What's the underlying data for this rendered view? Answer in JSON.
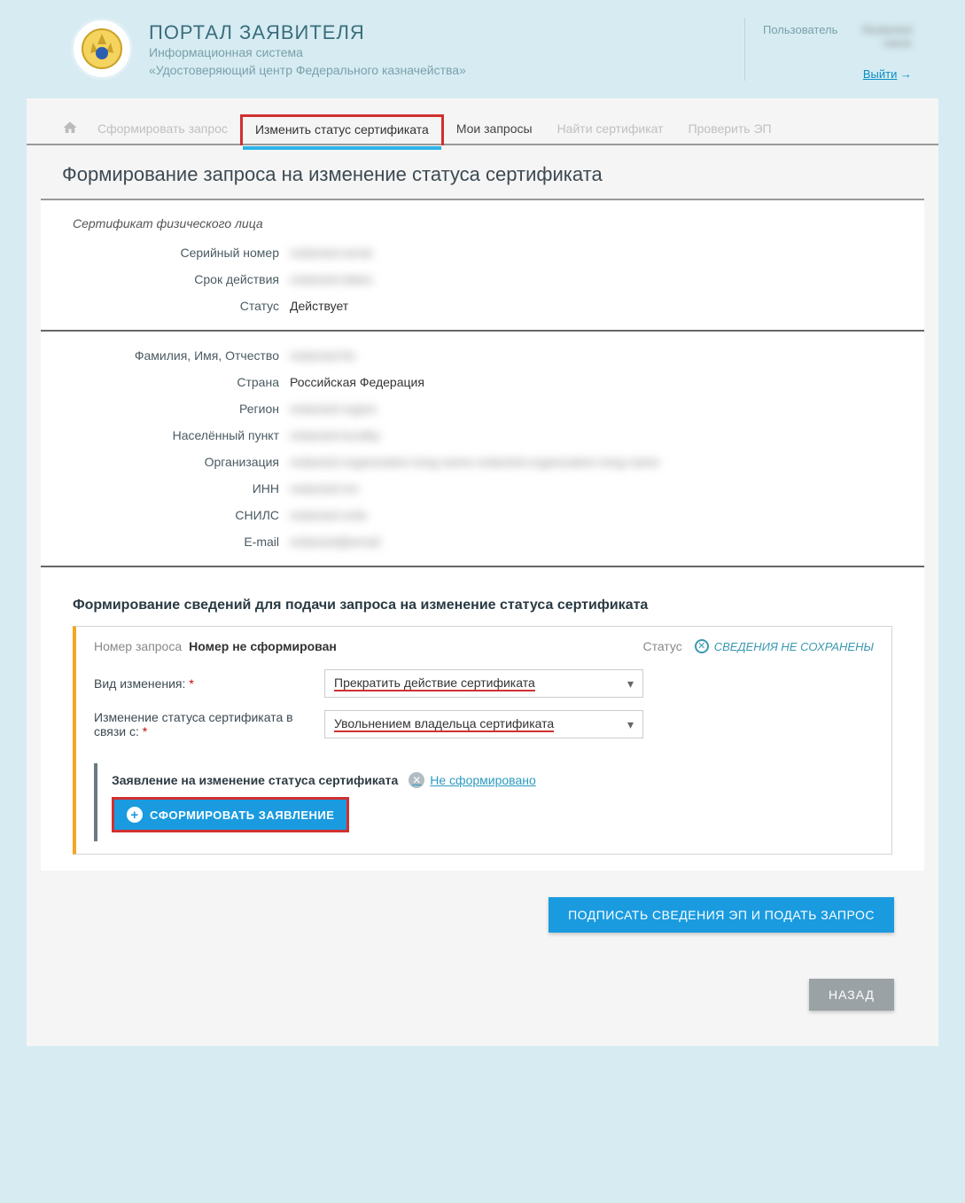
{
  "header": {
    "portal_title": "ПОРТАЛ ЗАЯВИТЕЛЯ",
    "portal_sub1": "Информационная система",
    "portal_sub2": "«Удостоверяющий центр Федерального казначейства»",
    "user_label": "Пользователь",
    "user_name": "Redacted name",
    "logout": "Выйти"
  },
  "nav": {
    "items": [
      {
        "label": "Сформировать запрос"
      },
      {
        "label": "Изменить статус сертификата"
      },
      {
        "label": "Мои запросы"
      },
      {
        "label": "Найти сертификат"
      },
      {
        "label": "Проверить ЭП"
      }
    ]
  },
  "page_title": "Формирование запроса на изменение статуса сертификата",
  "cert": {
    "section_label": "Сертификат физического лица",
    "serial_label": "Серийный номер",
    "serial_value": "redacted-serial",
    "validity_label": "Срок действия",
    "validity_value": "redacted-dates",
    "status_label": "Статус",
    "status_value": "Действует",
    "fio_label": "Фамилия, Имя, Отчество",
    "fio_value": "redacted-fio",
    "country_label": "Страна",
    "country_value": "Российская Федерация",
    "region_label": "Регион",
    "region_value": "redacted-region",
    "locality_label": "Населённый пункт",
    "locality_value": "redacted-locality",
    "org_label": "Организация",
    "org_value": "redacted-organization-long-name-redacted-organization-long-name",
    "inn_label": "ИНН",
    "inn_value": "redacted-inn",
    "snils_label": "СНИЛС",
    "snils_value": "redacted-snils",
    "email_label": "E-mail",
    "email_value": "redacted@email"
  },
  "form": {
    "title": "Формирование сведений для подачи запроса на изменение статуса сертификата",
    "req_no_label": "Номер запроса",
    "req_no_value": "Номер не сформирован",
    "status_label": "Статус",
    "status_value": "СВЕДЕНИЯ НЕ СОХРАНЕНЫ",
    "change_type_label": "Вид изменения:",
    "change_type_value": "Прекратить действие сертификата",
    "reason_label": "Изменение статуса сертификата в связи с:",
    "reason_value": "Увольнением владельца сертификата",
    "app_title": "Заявление на изменение статуса сертификата",
    "not_formed": " Не сформировано",
    "form_btn": "СФОРМИРОВАТЬ ЗАЯВЛЕНИЕ"
  },
  "buttons": {
    "submit": "ПОДПИСАТЬ СВЕДЕНИЯ ЭП И ПОДАТЬ ЗАПРОС",
    "back": "НАЗАД"
  }
}
